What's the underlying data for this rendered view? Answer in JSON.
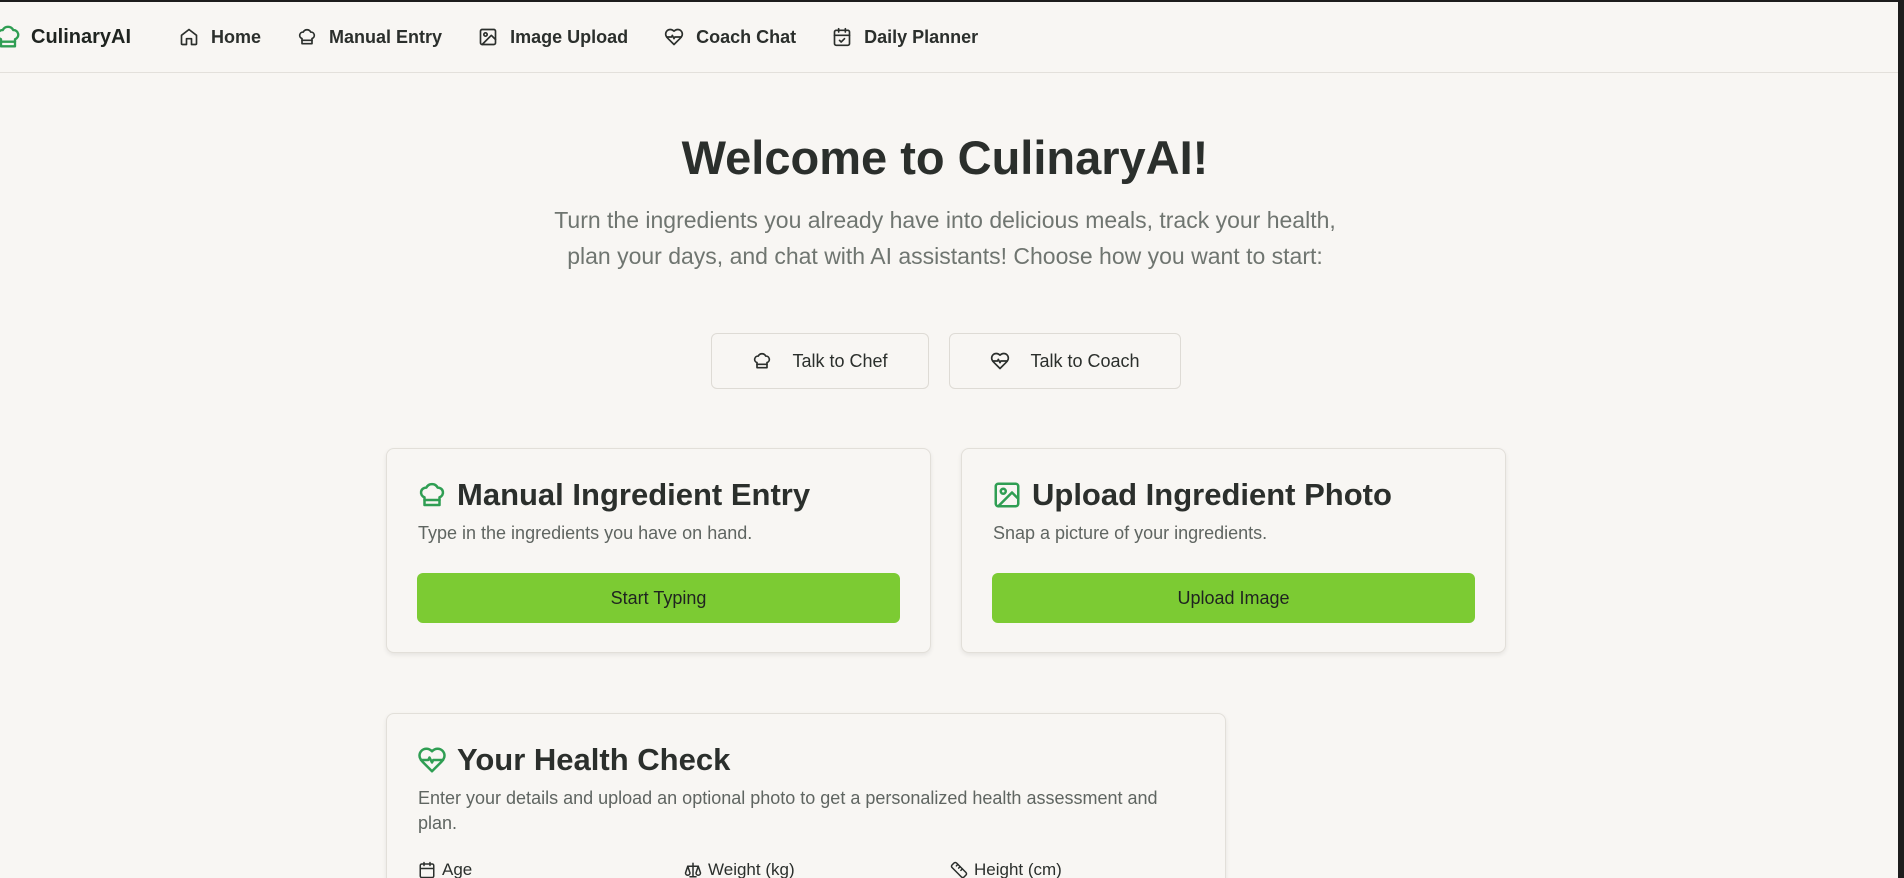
{
  "header": {
    "brand": "CulinaryAI",
    "nav": [
      {
        "label": "Home",
        "icon": "home-icon"
      },
      {
        "label": "Manual Entry",
        "icon": "chef-hat-icon"
      },
      {
        "label": "Image Upload",
        "icon": "image-plus-icon"
      },
      {
        "label": "Coach Chat",
        "icon": "heart-pulse-icon"
      },
      {
        "label": "Daily Planner",
        "icon": "calendar-check-icon"
      }
    ]
  },
  "hero": {
    "title": "Welcome to CulinaryAI!",
    "subtitle": "Turn the ingredients you already have into delicious meals, track your health, plan your days, and chat with AI assistants! Choose how you want to start:"
  },
  "quick_actions": {
    "chef": "Talk to Chef",
    "coach": "Talk to Coach"
  },
  "cards": {
    "manual": {
      "title": "Manual Ingredient Entry",
      "description": "Type in the ingredients you have on hand.",
      "button": "Start Typing"
    },
    "upload": {
      "title": "Upload Ingredient Photo",
      "description": "Snap a picture of your ingredients.",
      "button": "Upload Image"
    },
    "health": {
      "title": "Your Health Check",
      "description": "Enter your details and upload an optional photo to get a personalized health assessment and plan.",
      "fields": {
        "age": "Age",
        "weight": "Weight (kg)",
        "height": "Height (cm)"
      }
    }
  },
  "colors": {
    "accent_green": "#7ccb33",
    "icon_green": "#2f9e53",
    "background": "#f8f6f3"
  }
}
